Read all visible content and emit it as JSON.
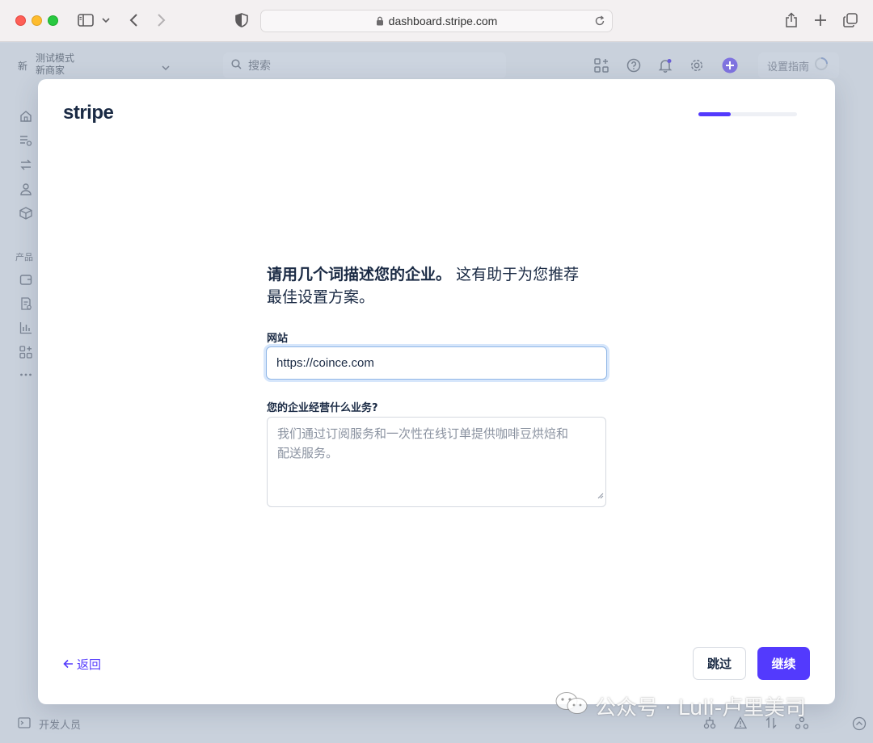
{
  "browser": {
    "url": "dashboard.stripe.com"
  },
  "dashboard": {
    "account_badge": "新",
    "account_mode": "测试模式",
    "account_name": "新商家",
    "search_placeholder": "搜索",
    "setup_guide_label": "设置指南",
    "products_section": "产品",
    "developers_label": "开发人员"
  },
  "modal": {
    "logo": "stripe",
    "progress": 0.33,
    "heading_bold": "请用几个词描述您的企业。",
    "heading_rest_line1": "这有助于为您推荐",
    "heading_line2": "最佳设置方案。",
    "website_label": "网站",
    "website_value": "https://coince.com",
    "business_label": "您的企业经营什么业务?",
    "business_placeholder_line1": "我们通过订阅服务和一次性在线订单提供咖啡豆烘焙和",
    "business_placeholder_line2": "配送服务。",
    "back_label": "返回",
    "skip_label": "跳过",
    "continue_label": "继续"
  },
  "colors": {
    "accent": "#533afd",
    "text_dark": "#1a2a44"
  },
  "watermark": {
    "text": "公众号 · Luli-卢里美司"
  }
}
